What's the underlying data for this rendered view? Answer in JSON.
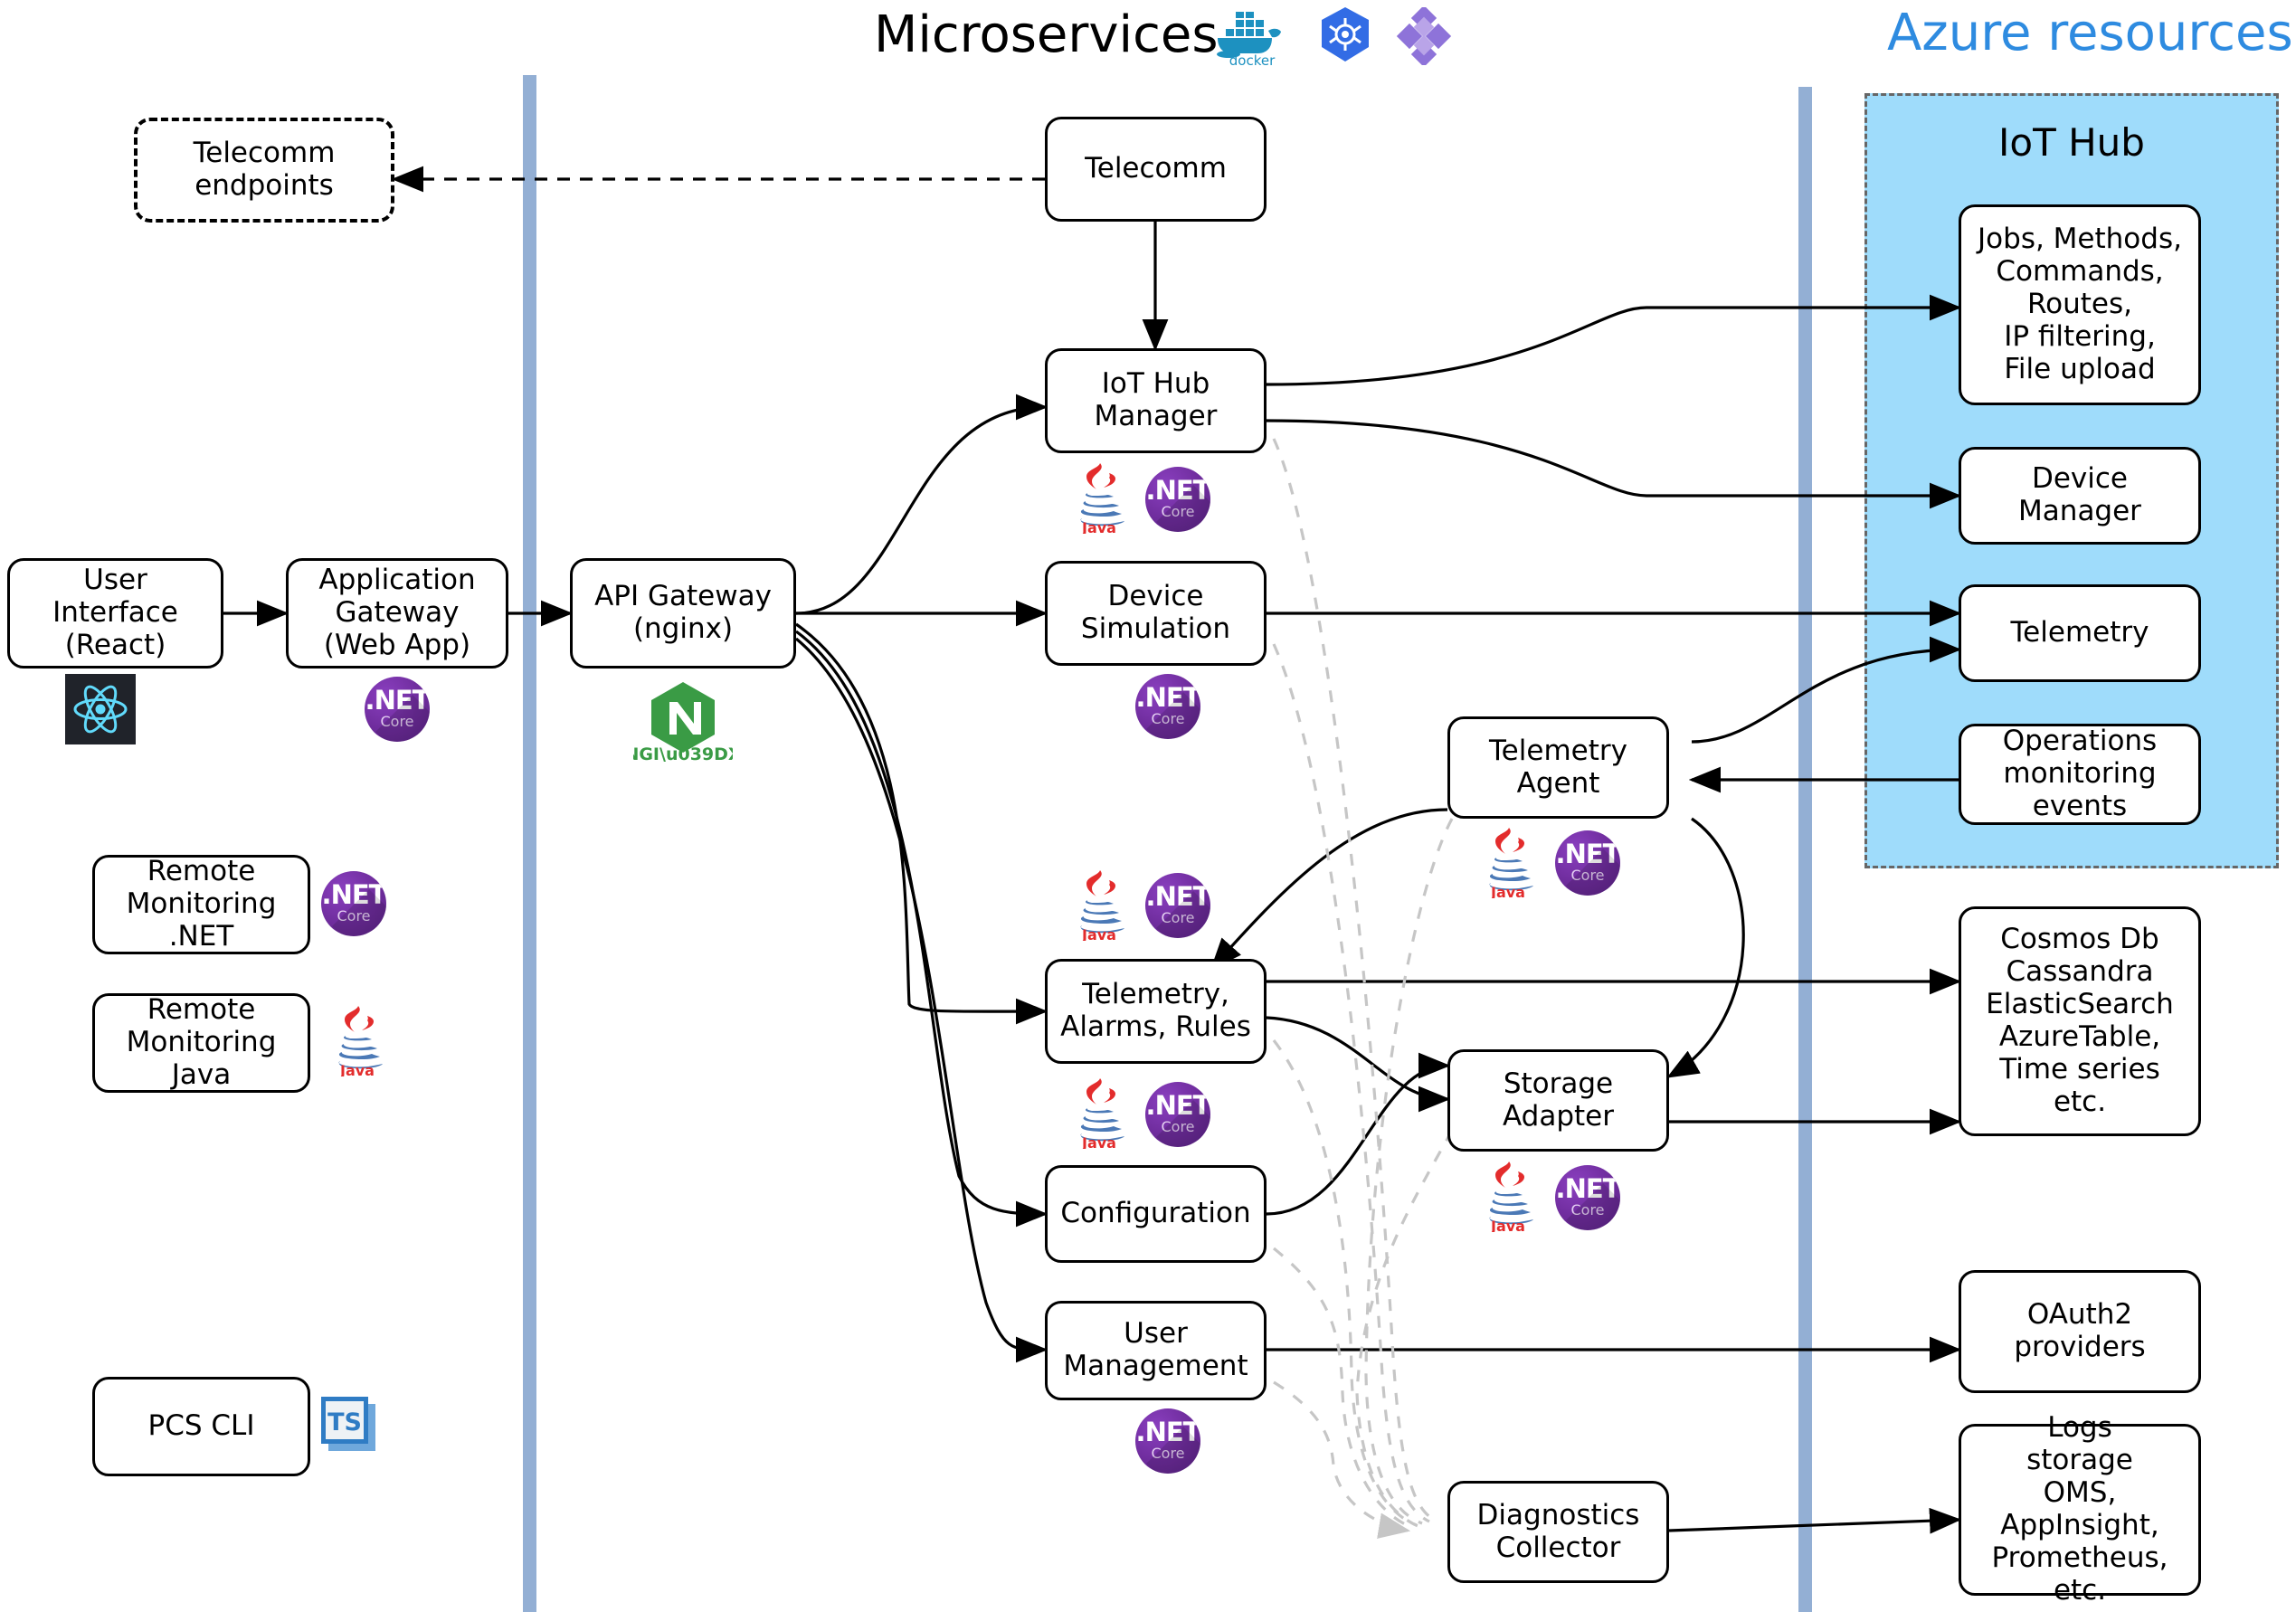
{
  "headers": {
    "microservices": "Microservices",
    "azure_resources": "Azure resources",
    "iot_hub_panel": "IoT Hub"
  },
  "logos": {
    "docker": "docker-logo",
    "kubernetes": "kubernetes-logo",
    "helm": "helm-logo",
    "react": "react-logo",
    "nginx": "nginx-logo",
    "typescript": "typescript-logo",
    "dotnet_core": ".NET Core",
    "dotnet_core_line1": ".NET",
    "dotnet_core_line2": "Core",
    "java": "Java"
  },
  "colors": {
    "swimlane": "#93AFD4",
    "azure_panel_fill": "#9FDCFB",
    "azure_title": "#2E8BE0",
    "dotnet_purple": "#6E2C9C",
    "nginx_green": "#3A9B45",
    "java_red": "#E32C2C",
    "java_blue": "#4B79B6",
    "typescript_blue": "#2F7CC4",
    "dashed_gray": "#C6C6C6"
  },
  "clients": [
    {
      "id": "telecomm-endpoints",
      "label": "Telecomm\nendpoints",
      "style": "dashed",
      "badges": []
    },
    {
      "id": "user-interface",
      "label": "User Interface\n(React)",
      "style": "solid",
      "badges": [
        "react"
      ]
    },
    {
      "id": "application-gateway",
      "label": "Application\nGateway\n(Web App)",
      "style": "solid",
      "badges": [
        "dotnet"
      ]
    },
    {
      "id": "remote-monitoring-net",
      "label": "Remote\nMonitoring .NET",
      "style": "solid",
      "badges": [
        "dotnet"
      ]
    },
    {
      "id": "remote-monitoring-java",
      "label": "Remote\nMonitoring Java",
      "style": "solid",
      "badges": [
        "java"
      ]
    },
    {
      "id": "pcs-cli",
      "label": "PCS CLI",
      "style": "solid",
      "badges": [
        "typescript"
      ]
    }
  ],
  "gateway": {
    "id": "api-gateway",
    "label": "API Gateway\n(nginx)",
    "badges": [
      "nginx"
    ]
  },
  "microservices": [
    {
      "id": "telecomm",
      "label": "Telecomm",
      "badges": []
    },
    {
      "id": "iot-hub-manager",
      "label": "IoT Hub\nManager",
      "badges": [
        "java",
        "dotnet"
      ]
    },
    {
      "id": "device-simulation",
      "label": "Device\nSimulation",
      "badges": [
        "dotnet"
      ]
    },
    {
      "id": "telemetry-agent",
      "label": "Telemetry\nAgent",
      "badges": [
        "java",
        "dotnet"
      ]
    },
    {
      "id": "telemetry-alarms-rules",
      "label": "Telemetry,\nAlarms, Rules",
      "badges": [
        "java",
        "dotnet"
      ]
    },
    {
      "id": "storage-adapter",
      "label": "Storage\nAdapter",
      "badges": [
        "java",
        "dotnet"
      ]
    },
    {
      "id": "configuration",
      "label": "Configuration",
      "badges": [
        "java",
        "dotnet"
      ]
    },
    {
      "id": "user-management",
      "label": "User\nManagement",
      "badges": [
        "dotnet"
      ]
    },
    {
      "id": "diagnostics-collector",
      "label": "Diagnostics\nCollector",
      "badges": []
    }
  ],
  "azure": {
    "iot_hub_children": [
      {
        "id": "jobs-methods-commands",
        "label": "Jobs, Methods,\nCommands,\nRoutes,\nIP filtering,\nFile upload"
      },
      {
        "id": "device-manager",
        "label": "Device Manager"
      },
      {
        "id": "telemetry",
        "label": "Telemetry"
      },
      {
        "id": "operations-monitoring-events",
        "label": "Operations\nmonitoring events"
      }
    ],
    "external": [
      {
        "id": "cosmos-db-storage",
        "label": "Cosmos Db\nCassandra\nElasticSearch\nAzureTable,\nTime series\netc."
      },
      {
        "id": "oauth2-providers",
        "label": "OAuth2\nproviders"
      },
      {
        "id": "logs-storage",
        "label": "Logs\nstorage\nOMS, AppInsight,\nPrometheus, etc."
      }
    ]
  }
}
